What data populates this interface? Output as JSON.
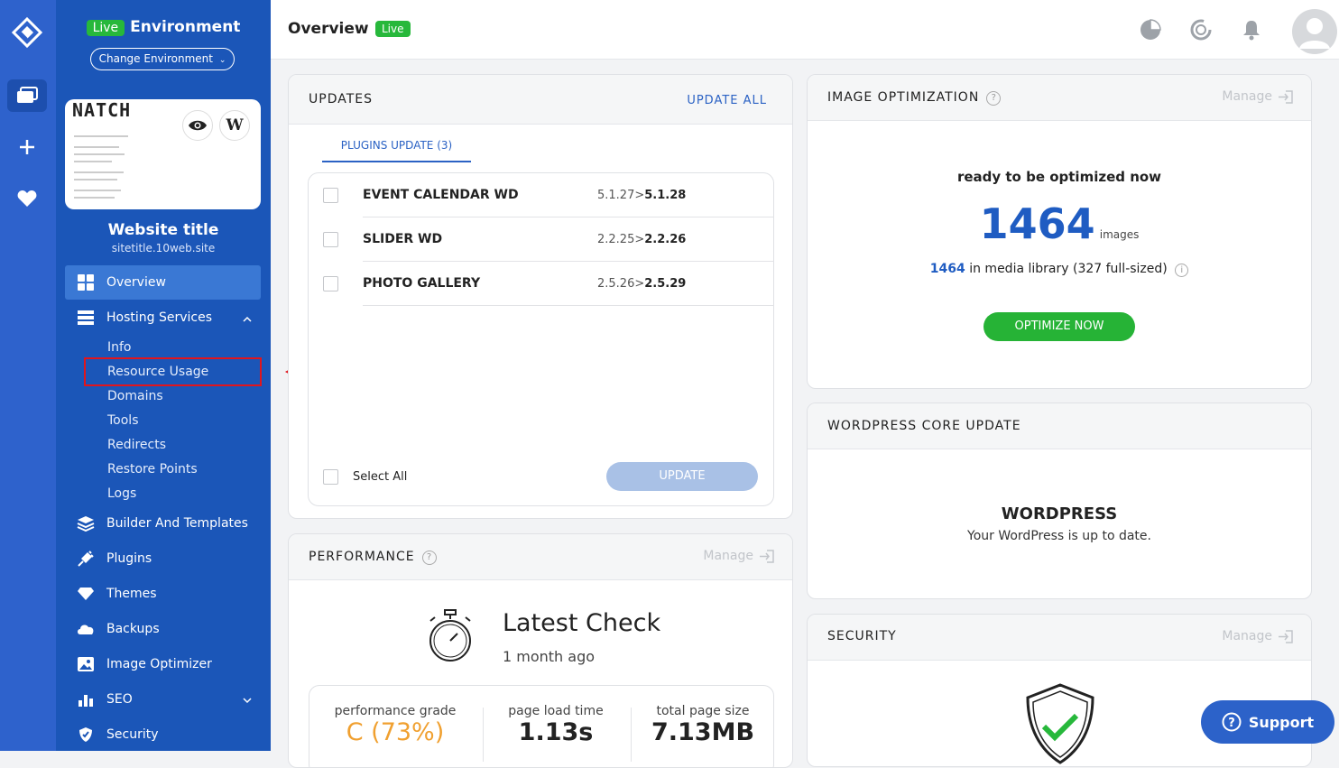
{
  "environment": {
    "badge": "Live",
    "label": "Environment",
    "change_button": "Change Environment"
  },
  "site": {
    "thumbnail_title": "NATCH",
    "title": "Website title",
    "url": "sitetitle.10web.site"
  },
  "sidebar": {
    "items": [
      {
        "label": "Overview",
        "icon": "grid-icon"
      },
      {
        "label": "Hosting Services",
        "icon": "server-icon"
      },
      {
        "label": "Builder And Templates",
        "icon": "layers-icon"
      },
      {
        "label": "Plugins",
        "icon": "plug-icon"
      },
      {
        "label": "Themes",
        "icon": "diamond-icon"
      },
      {
        "label": "Backups",
        "icon": "cloud-icon"
      },
      {
        "label": "Image Optimizer",
        "icon": "image-icon"
      },
      {
        "label": "SEO",
        "icon": "bar-chart-icon"
      },
      {
        "label": "Security",
        "icon": "shield-icon"
      }
    ],
    "hosting_subitems": [
      "Info",
      "Resource Usage",
      "Domains",
      "Tools",
      "Redirects",
      "Restore Points",
      "Logs"
    ]
  },
  "header": {
    "title": "Overview",
    "badge": "Live"
  },
  "updates": {
    "title": "UPDATES",
    "update_all": "UPDATE ALL",
    "tab": "PLUGINS UPDATE (3)",
    "plugins": [
      {
        "name": "EVENT CALENDAR WD",
        "from": "5.1.27",
        "to": "5.1.28"
      },
      {
        "name": "SLIDER WD",
        "from": "2.2.25",
        "to": "2.2.26"
      },
      {
        "name": "PHOTO GALLERY",
        "from": "2.5.26",
        "to": "2.5.29"
      }
    ],
    "select_all": "Select All",
    "update_button": "UPDATE"
  },
  "image_optimization": {
    "title": "IMAGE OPTIMIZATION",
    "manage": "Manage",
    "ready_text": "ready to be optimized now",
    "count": "1464",
    "count_unit": "images",
    "library_count": "1464",
    "library_text": "in media library (327 full-sized)",
    "button": "OPTIMIZE NOW"
  },
  "wordpress_core": {
    "title": "WORDPRESS CORE UPDATE",
    "heading": "WORDPRESS",
    "status": "Your WordPress is up to date."
  },
  "performance": {
    "title": "PERFORMANCE",
    "manage": "Manage",
    "latest_check": "Latest Check",
    "when": "1 month ago",
    "stats": [
      {
        "label": "performance grade",
        "value": "C (73%)"
      },
      {
        "label": "page load time",
        "value": "1.13s"
      },
      {
        "label": "total page size",
        "value": "7.13MB"
      }
    ]
  },
  "security": {
    "title": "SECURITY",
    "manage": "Manage"
  },
  "support": {
    "label": "Support"
  },
  "colors": {
    "sidebar": "#1b56b8",
    "rail": "#2e62cc",
    "live_green": "#27b83b",
    "accent_blue": "#2b62c4",
    "grade_orange": "#f0a030",
    "highlight_red": "#e2151c"
  }
}
